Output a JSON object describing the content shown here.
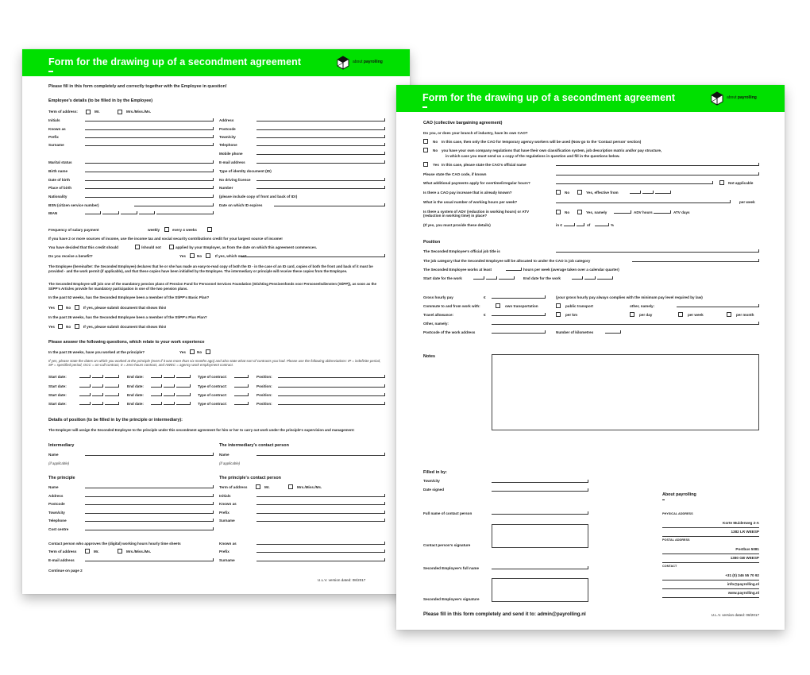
{
  "brand": {
    "primary_color": "#00e000",
    "logo_text_light": "about ",
    "logo_text_bold": "payrolling"
  },
  "form_title": "Form for the drawing up of a secondment agreement",
  "page1": {
    "intro": "Please fill in this form completely and correctly together with the Employee in question!",
    "employee_heading": "Employee's details (to be filled in by the Employee)",
    "term_of_address": "Term of address:",
    "mr": "Mr.",
    "mrs": "Mrs./Miss./Ms.",
    "left_fields": [
      "Initials",
      "Known as",
      "Prefix",
      "Surname",
      "Marital status",
      "Birth name",
      "Date of birth",
      "Place of birth",
      "Nationality",
      "BSN (citizen service number)",
      "IBAN"
    ],
    "right_fields": [
      "Address",
      "Postcode",
      "Town/city",
      "Telephone",
      "Mobile phone",
      "E-mail address",
      "Type of identity document (ID)",
      "No driving licence",
      "Number",
      "(please include copy of front and back of ID!)",
      "Date on which ID expires"
    ],
    "salary_freq": "Frequency of salary payment",
    "weekly": "weekly",
    "every4": "every 4 weeks",
    "income_note": "If you have 2 or more sources of income, use the income tax and social security contributions credit for your largest source of income!",
    "credit_a": "You have decided that this credit should",
    "credit_b": "/should not",
    "credit_c": "applied by your Employer, as from the date on which this agreement commences.",
    "benefit_q": "Do you receive a benefit?",
    "yes": "Yes",
    "no": "No",
    "which_one": "If yes, which one?",
    "para1": "The Employee (hereinafter: the Seconded Employee) declares that he or she has made an easy-to-read copy of both the ID - in the case of an ID card, copies of both the front and back of it must be provided - and the work permit (if applicable), and that these copies have been initialled by the Employee. The intermediary or principle will receive these copies from the Employee.",
    "para2": "The Seconded Employee will join one of the mandatory pension plans of Pension Fund for Personnel Services Foundation (Stichting Pensioenfonds voor Personeelsdiensten (StiPP)), as soon as the StiPP's Articles provide for mandatory participation in one of the two pension plans.",
    "basic_q": "In the past 52 weeks, has the Seconded Employee been a member of the StiPP's Basic Plan?",
    "plus_q": "In the past 26 weeks, has the Seconded Employee been a member of the StiPP's Plus Plan?",
    "submit_doc": "If yes, please submit document that shows this!",
    "work_heading": "Please answer the following questions, which relate to your work experience",
    "worked_q": "In the past 26 weeks, have you worked at the principle?",
    "work_italic": "If yes, please state the dates on which you worked at the principle (even if it was more than six months ago) and also state what sort of contracts you had. Please use the following abbreviations: IP = indefinite period, SP = specified period, OCC = on-call contract, 0 = zero-hours contract, and AWEC = agency work employment contract.",
    "start_date": "Start date:",
    "end_date": "End date:",
    "type_contract": "Type of contract:",
    "position": "Position:",
    "position_heading": "Details of position (to be filled in by the principle or intermediary):",
    "position_para": "The Employer will assign the Seconded Employee to the principle under this secondment agreement for him or her to carry out work under the principle's supervision and management:",
    "intermediary": "Intermediary",
    "intermediary_contact": "The intermediary's contact person",
    "name": "Name",
    "if_applicable": "(if applicable)",
    "principle": "The principle",
    "principle_contact": "The principle's contact person",
    "principle_fields": [
      "Name",
      "Address",
      "Postcode",
      "Town/city",
      "Telephone",
      "Cost centre"
    ],
    "pcontact_term": "Term of address",
    "pcontact_fields": [
      "Initials",
      "Known as",
      "Prefix",
      "Surname"
    ],
    "approver": "Contact person who approves the (digital) working hours hourly time sheets",
    "term_of_address2": "Term of address",
    "email_address": "E-mail address",
    "approver_right": [
      "Known as",
      "Prefix",
      "Surname"
    ],
    "continue": "Continue on page 2",
    "version": "U.L.V. version dated: 08/2017"
  },
  "page2": {
    "cao_heading": "CAO (collective bargaining agreement)",
    "cao_q": "Do you, or does your branch of industry, have its own CAO?",
    "opt1_label": "No",
    "opt1_text": "In this case, then only the CAO for temporary agency workers will be used (Now go to the 'Contact person' section)",
    "opt2_label": "No",
    "opt2_text_a": "you have your own company regulations that have their own classification system, job description matrix and/or pay structure,",
    "opt2_text_b": "in which case you must send us a copy of the regulations in question and fill in the questions below.",
    "opt3_label": "Yes",
    "opt3_text": "In this case, please state the CAO's official name",
    "cao_code": "Please state the CAO code, if known",
    "additional": "What additional payments apply for overtime/irregular hours?",
    "not_applicable": "Not applicable",
    "pay_increase": "Is there a CAO pay increase that is already known?",
    "no": "No",
    "yes_effective": "Yes, effective from",
    "usual_hours": "What is the usual number of working hours per week?",
    "per_week": "per week",
    "adv_q_a": "Is there a system of ADV (reduction in working hours) or ATV",
    "adv_q_b": "(reduction in working time) in place?",
    "yes_namely": "Yes, namely",
    "adv_hours": "ADV hours",
    "atv_days": "ATV days",
    "details": "(If yes, you must provide these details)",
    "in_eur": "in €",
    "of": "of",
    "pct": "%",
    "position_heading": "Position",
    "job_title": "The Seconded Employee's official job title is",
    "job_category": "The job category that the Seconded Employee will be allocated to under the CAO is job category",
    "works_at_least": "The Seconded Employee works at least",
    "hours_note": "hours per week (average taken over a calendar quarter)",
    "start_work": "Start date for the work",
    "end_work": "End date for the work",
    "gross_pay": "Gross hourly pay",
    "euro": "€",
    "gross_note": "(your gross hourly pay always complies with the minimum pay level required by law)",
    "commute": "Commute to and from work with:",
    "own_transport": "own transportation",
    "public_transport": "public transport",
    "other_namely": "other, namely:",
    "travel_allowance": "Travel allowance:",
    "per_km": "per km",
    "per_day": "per day",
    "per_week2": "per week",
    "per_month": "per month",
    "other_namely2": "Other, namely:",
    "postcode_work": "Postcode of the work address",
    "km": "Number of kilometres",
    "notes": "Notes",
    "filled_by": "Filled in by:",
    "town": "Town/city",
    "date_signed": "Date signed",
    "contact_name": "Full name of contact person",
    "contact_sig": "Contact person's signature",
    "emp_name": "Seconded Employee's full name",
    "emp_sig": "Seconded Employee's signature",
    "send_note": "Please fill in this form completely and send it to: admin@payrolling.nl",
    "about_heading": "About payrolling",
    "physical_label": "PHYSICAL ADDRESS",
    "physical_lines": [
      "Korte Muiderweg 2-A",
      "1382 LR  WEESP"
    ],
    "postal_label": "POSTAL ADDRESS",
    "postal_lines": [
      "Postbus 5081",
      "1380 GB  WEESP"
    ],
    "contact_label": "CONTACT",
    "contact_lines": [
      "+31 (0) 346 55 70 92",
      "info@payrolling.nl",
      "www.payrolling.nl"
    ],
    "version": "U.L.V. version dated: 08/2017"
  }
}
